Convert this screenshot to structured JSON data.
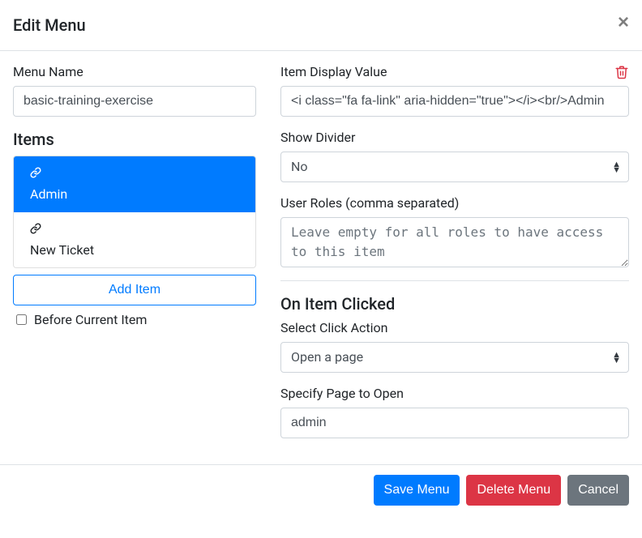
{
  "header": {
    "title": "Edit Menu"
  },
  "left": {
    "menu_name_label": "Menu Name",
    "menu_name_value": "basic-training-exercise",
    "items_heading": "Items",
    "items": [
      {
        "label": "Admin",
        "active": true
      },
      {
        "label": "New Ticket",
        "active": false
      }
    ],
    "add_item_label": "Add Item",
    "before_current_label": "Before Current Item",
    "before_current_checked": false
  },
  "right": {
    "display_value_label": "Item Display Value",
    "display_value_value": "<i class=\"fa fa-link\" aria-hidden=\"true\"></i><br/>Admin",
    "show_divider_label": "Show Divider",
    "show_divider_value": "No",
    "user_roles_label": "User Roles (comma separated)",
    "user_roles_value": "",
    "user_roles_placeholder": "Leave empty for all roles to have access to this item",
    "on_click_heading": "On Item Clicked",
    "click_action_label": "Select Click Action",
    "click_action_value": "Open a page",
    "specify_page_label": "Specify Page to Open",
    "specify_page_value": "admin"
  },
  "footer": {
    "save": "Save Menu",
    "delete": "Delete Menu",
    "cancel": "Cancel"
  }
}
